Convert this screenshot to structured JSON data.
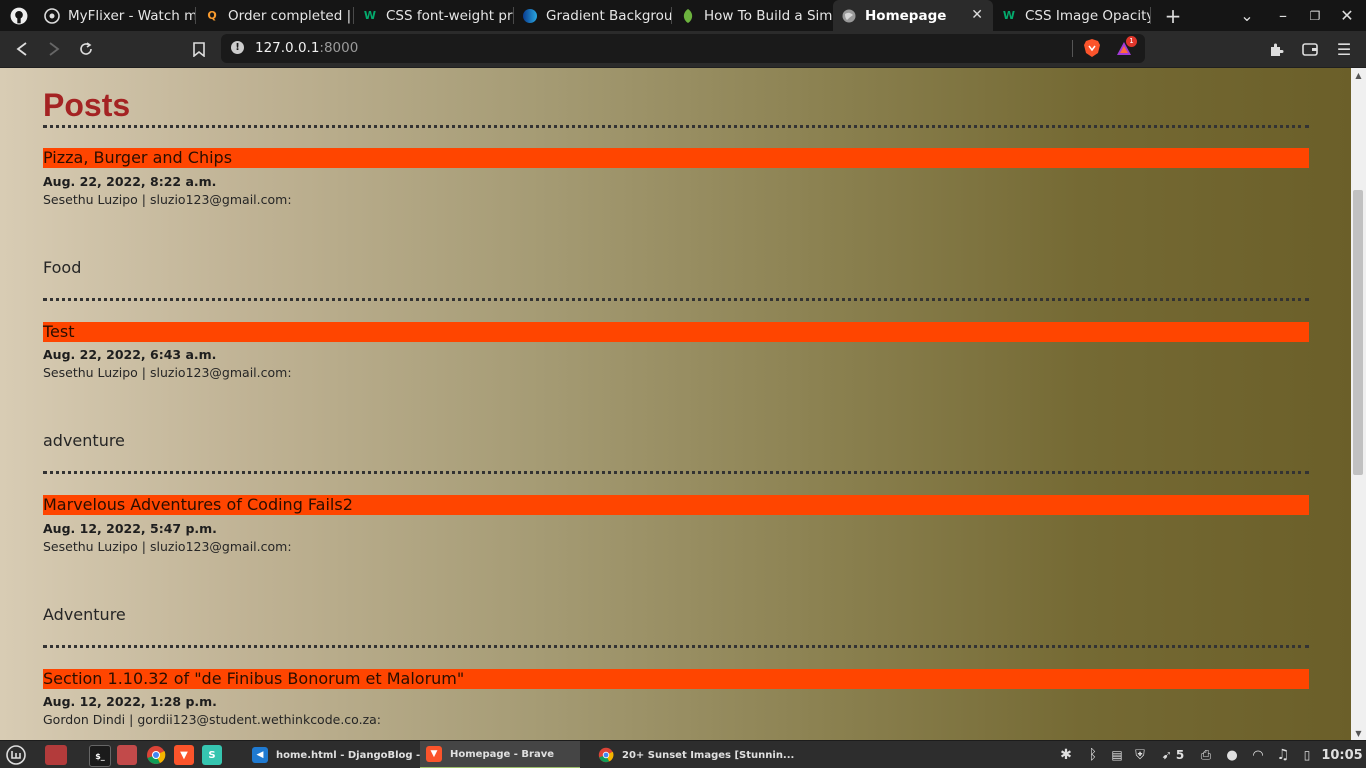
{
  "browser": {
    "tabs": [
      {
        "label": "MyFlixer - Watch mov",
        "icon": "github-icon"
      },
      {
        "label": "Order completed | Q",
        "icon": "search-q-icon"
      },
      {
        "label": "CSS font-weight prop",
        "icon": "w3-icon"
      },
      {
        "label": "Gradient Backgrounds",
        "icon": "gradient-icon"
      },
      {
        "label": "How To Build a Simp",
        "icon": "leaf-icon"
      },
      {
        "label": "Homepage",
        "icon": "globe-icon",
        "active": true
      },
      {
        "label": "CSS Image Opacity /",
        "icon": "w3-icon"
      }
    ],
    "url_host": "127.0.0.1",
    "url_port": ":8000",
    "rewards_badge": "1"
  },
  "page": {
    "heading": "Posts",
    "posts": [
      {
        "title": "Pizza, Burger and Chips",
        "date": "Aug. 22, 2022, 8:22 a.m.",
        "author": "Sesethu Luzipo | sluzio123@gmail.com:",
        "category": "Food"
      },
      {
        "title": "Test",
        "date": "Aug. 22, 2022, 6:43 a.m.",
        "author": "Sesethu Luzipo | sluzio123@gmail.com:",
        "category": "adventure"
      },
      {
        "title": "Marvelous Adventures of Coding Fails2",
        "date": "Aug. 12, 2022, 5:47 p.m.",
        "author": "Sesethu Luzipo | sluzio123@gmail.com:",
        "category": "Adventure"
      },
      {
        "title": "Section 1.10.32 of \"de Finibus Bonorum et Malorum\"",
        "date": "Aug. 12, 2022, 1:28 p.m.",
        "author": "Gordon Dindi | gordii123@student.wethinkcode.co.za:"
      }
    ]
  },
  "colors": {
    "heading": "#a42323",
    "title_bar": "#ff4500"
  },
  "taskbar": {
    "windows": [
      {
        "label": "home.html - DjangoBlog - Vi...",
        "icon": "vscode-icon"
      },
      {
        "label": "Homepage - Brave",
        "icon": "brave-icon",
        "active": true
      },
      {
        "label": "20+ Sunset Images [Stunnin...",
        "icon": "chrome-icon"
      }
    ],
    "notification_count": "5",
    "clock": "10:05"
  }
}
